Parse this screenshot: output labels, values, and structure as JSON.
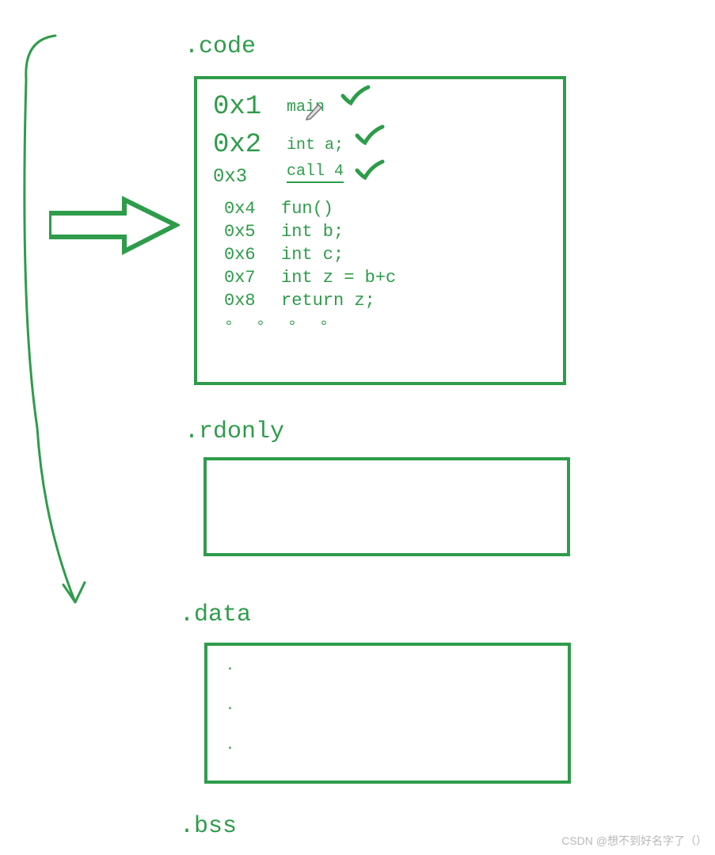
{
  "sections": {
    "code": {
      "label": ".code"
    },
    "rdonly": {
      "label": ".rdonly"
    },
    "data": {
      "label": ".data"
    },
    "bss": {
      "label": ".bss"
    }
  },
  "code_lines_top": {
    "line1": {
      "addr": "0x1",
      "instr": "main"
    },
    "line2": {
      "addr": "0x2",
      "instr": "int a;"
    },
    "line3": {
      "addr": "0x3",
      "instr": "call 4"
    }
  },
  "code_lines_bottom": {
    "line4": {
      "addr": "0x4",
      "instr": "fun()"
    },
    "line5": {
      "addr": "0x5",
      "instr": "int b;"
    },
    "line6": {
      "addr": "0x6",
      "instr": "int c;"
    },
    "line7": {
      "addr": "0x7",
      "instr": "int z = b+c"
    },
    "line8": {
      "addr": "0x8",
      "instr": "return z;"
    }
  },
  "dots": "° ° ° °",
  "watermark": "CSDN @想不到好名字了（）"
}
